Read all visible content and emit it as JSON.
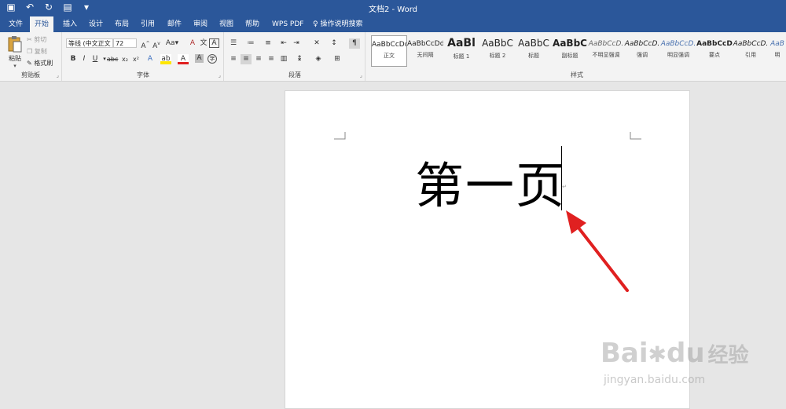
{
  "window": {
    "title": "文档2  -  Word"
  },
  "tabs": [
    "文件",
    "开始",
    "插入",
    "设计",
    "布局",
    "引用",
    "邮件",
    "审阅",
    "视图",
    "帮助",
    "WPS PDF",
    "操作说明搜索"
  ],
  "clipboard": {
    "paste": "粘贴",
    "cut": "剪切",
    "copy": "复制",
    "painter": "格式刷",
    "label": "剪贴板"
  },
  "font": {
    "name": "等线 (中文正文",
    "size": "72",
    "label": "字体"
  },
  "paragraph": {
    "label": "段落"
  },
  "styles": {
    "label": "样式",
    "items": [
      {
        "preview": "AaBbCcDd",
        "name": "正文"
      },
      {
        "preview": "AaBbCcDd",
        "name": "无间隔"
      },
      {
        "preview": "AaBl",
        "name": "标题 1"
      },
      {
        "preview": "AaBbC",
        "name": "标题 2"
      },
      {
        "preview": "AaBbC",
        "name": "标题"
      },
      {
        "preview": "AaBbC",
        "name": "副标题"
      },
      {
        "preview": "AaBbCcD.",
        "name": "不明显强调"
      },
      {
        "preview": "AaBbCcD.",
        "name": "强调"
      },
      {
        "preview": "AaBbCcD.",
        "name": "明显强调"
      },
      {
        "preview": "AaBbCcD",
        "name": "要点"
      },
      {
        "preview": "AaBbCcD.",
        "name": "引用"
      },
      {
        "preview": "AaB",
        "name": "明"
      }
    ]
  },
  "document": {
    "text": "第一页"
  },
  "watermark": {
    "brand": "Bai",
    "brand2": "du",
    "cn": "经验",
    "url": "jingyan.baidu.com"
  },
  "colors": {
    "titlebar": "#2b579a",
    "arrow": "#e02020"
  }
}
